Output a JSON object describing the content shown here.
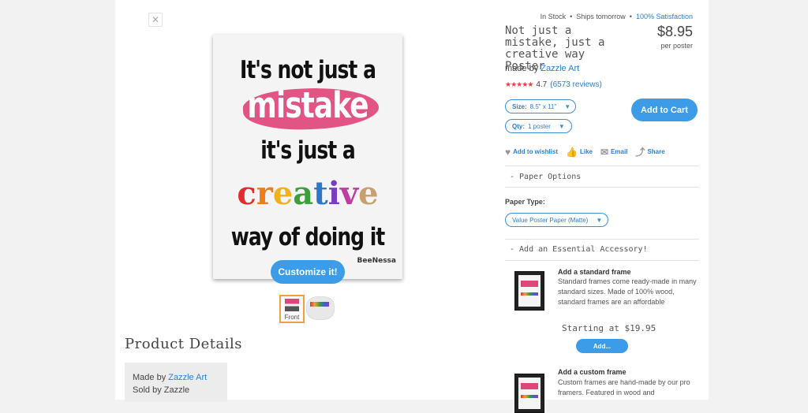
{
  "gallery": {
    "customize_label": "Customize it!",
    "thumbnail_front_label": "Front"
  },
  "poster_art": {
    "line1": "It's not just a",
    "line2": "mistake",
    "line3": "it's just a",
    "line4_letters": [
      {
        "ch": "c",
        "color": "#e02e2e"
      },
      {
        "ch": "r",
        "color": "#f07c1c"
      },
      {
        "ch": "e",
        "color": "#f0b020"
      },
      {
        "ch": "a",
        "color": "#3aa03a"
      },
      {
        "ch": "t",
        "color": "#2c78c8"
      },
      {
        "ch": "i",
        "color": "#7a3cc0"
      },
      {
        "ch": "v",
        "color": "#c03ca0"
      },
      {
        "ch": "e",
        "color": "#c8a070"
      }
    ],
    "line5": "way of doing it",
    "signature": "BeeNessa"
  },
  "details": {
    "heading": "Product Details",
    "made_by_prefix": "Made by",
    "made_by_link": "Zazzle Art",
    "sold_by": "Sold by Zazzle"
  },
  "product": {
    "stock": "In Stock",
    "ships": "Ships tomorrow",
    "satisfaction": "100% Satisfaction",
    "title": "Not just a mistake, just a creative way Poster",
    "price": "$8.95",
    "per": "per poster",
    "made_by_prefix": "made by",
    "made_by_link": "Zazzle Art",
    "rating": "4.7",
    "rating_stars": 4.7,
    "reviews": "(6573 reviews)",
    "size_label": "Size:",
    "size_value": "8.5\" x 11\"",
    "qty_label": "Qty:",
    "qty_value": "1 poster",
    "add_to_cart": "Add to Cart"
  },
  "social": {
    "wishlist": "Add to wishlist",
    "like": "Like",
    "email": "Email",
    "share": "Share"
  },
  "paper_options": {
    "heading": "- Paper Options",
    "type_label": "Paper Type:",
    "type_value": "Value Poster Paper (Matte)"
  },
  "accessory": {
    "heading": "- Add an Essential Accessory!",
    "items": [
      {
        "title": "Add a standard frame",
        "description": "Standard frames come ready-made in many standard sizes. Made of 100% wood, standard frames are an affordable",
        "starting": "Starting at $19.95",
        "add_label": "Add..."
      },
      {
        "title": "Add a custom frame",
        "description": "Custom frames are hand-made by our pro framers. Featured in wood and"
      }
    ]
  },
  "colors": {
    "accent": "#3d9ce8",
    "link": "#2a7fd4",
    "poster_pink": "#e0457a",
    "stars": "#e14646"
  }
}
